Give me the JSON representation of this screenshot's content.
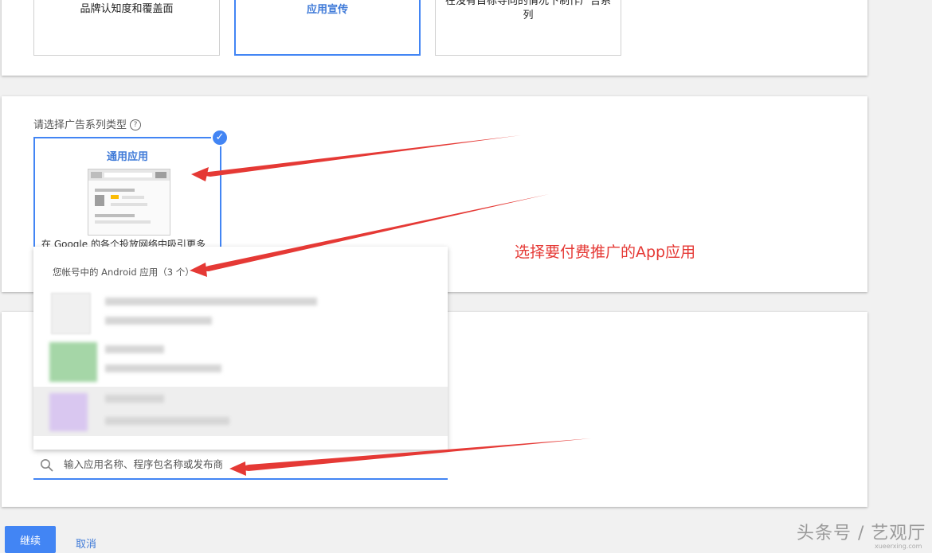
{
  "goals": [
    {
      "label": "品牌认知度和覆盖面",
      "selected": false
    },
    {
      "label": "应用宣传",
      "selected": true
    },
    {
      "label": "在没有目标导向的情况下制作广告系列",
      "selected": false
    }
  ],
  "campaign_type": {
    "label": "请选择广告系列类型",
    "help_icon": "help-circle-icon",
    "card_title": "通用应用",
    "card_desc": "在 Google 的各个投放网络中吸引更多"
  },
  "app_dropdown": {
    "header": "您帐号中的 Android 应用（3 个）",
    "apps": [
      {
        "name": "",
        "package": "",
        "highlighted": false
      },
      {
        "name": "",
        "package": "",
        "highlighted": false
      },
      {
        "name": "",
        "package": "",
        "highlighted": true
      }
    ]
  },
  "search": {
    "placeholder": "输入应用名称、程序包名称或发布商"
  },
  "buttons": {
    "continue": "继续",
    "cancel": "取消"
  },
  "annotation": "选择要付费推广的App应用",
  "watermark": {
    "text": "头条号 / 艺观厅",
    "sub": "xueerxing.com"
  },
  "colors": {
    "accent": "#4285f4",
    "annotation": "#e53935"
  }
}
